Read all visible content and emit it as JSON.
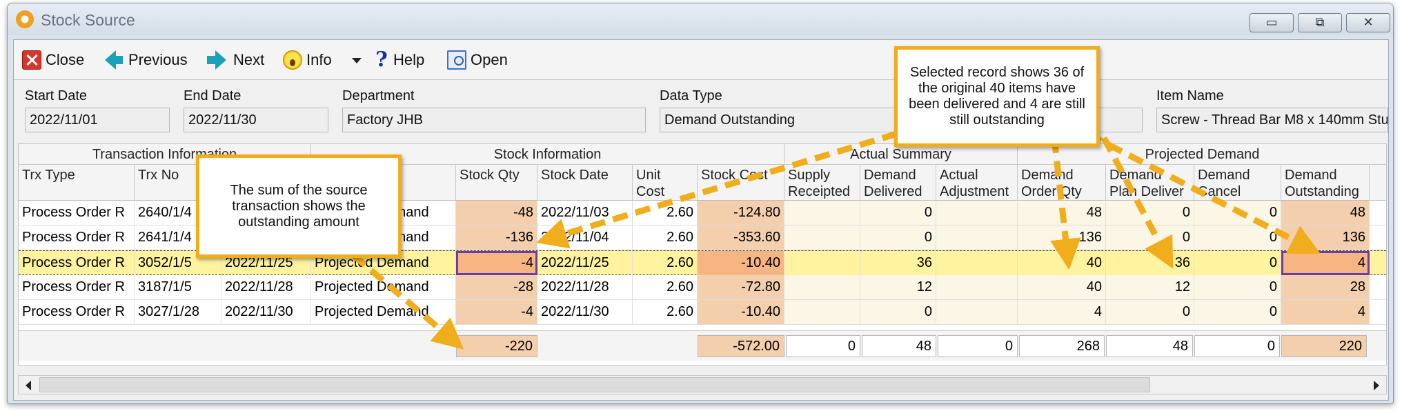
{
  "window": {
    "title": "Stock Source",
    "minimize": "▭",
    "maximize": "⧉",
    "close": "✕"
  },
  "toolbar": {
    "close_label": "Close",
    "previous_label": "Previous",
    "next_label": "Next",
    "info_label": "Info",
    "help_label": "Help",
    "open_label": "Open"
  },
  "filters": {
    "start_date": {
      "label": "Start Date",
      "value": "2022/11/01"
    },
    "end_date": {
      "label": "End Date",
      "value": "2022/11/30"
    },
    "department": {
      "label": "Department",
      "value": "Factory JHB"
    },
    "data_type": {
      "label": "Data Type",
      "value": "Demand Outstanding"
    },
    "item_name": {
      "label": "Item Name",
      "value": "Screw - Thread Bar M8 x 140mm Stu"
    }
  },
  "grid": {
    "bands": [
      "Transaction Information",
      "Stock Information",
      "Actual Summary",
      "Projected Demand"
    ],
    "headers": [
      "Trx Type",
      "Trx No",
      "",
      "",
      "Stock Qty",
      "Stock Date",
      "Unit\nCost",
      "Stock Cost",
      "Supply\nReceipted",
      "Demand\nDelivered",
      "Actual\nAdjustment",
      "Demand\nOrder Qty",
      "Demand\nPlan Deliver",
      "Demand\nCancel",
      "Demand\nOutstanding"
    ],
    "rows": [
      [
        "Process Order R",
        "2640/1/4",
        "",
        "Projected Demand",
        "-48",
        "2022/11/03",
        "2.60",
        "-124.80",
        "",
        "0",
        "",
        "48",
        "0",
        "0",
        "48"
      ],
      [
        "Process Order R",
        "2641/1/4",
        "",
        "Projected Demand",
        "-136",
        "2022/11/04",
        "2.60",
        "-353.60",
        "",
        "0",
        "",
        "136",
        "0",
        "0",
        "136"
      ],
      [
        "Process Order R",
        "3052/1/5",
        "2022/11/25",
        "Projected Demand",
        "-4",
        "2022/11/25",
        "2.60",
        "-10.40",
        "",
        "36",
        "",
        "40",
        "36",
        "0",
        "4"
      ],
      [
        "Process Order R",
        "3187/1/5",
        "2022/11/28",
        "Projected Demand",
        "-28",
        "2022/11/28",
        "2.60",
        "-72.80",
        "",
        "12",
        "",
        "40",
        "12",
        "0",
        "28"
      ],
      [
        "Process Order R",
        "3027/1/28",
        "2022/11/30",
        "Projected Demand",
        "-4",
        "2022/11/30",
        "2.60",
        "-10.40",
        "",
        "0",
        "",
        "4",
        "0",
        "0",
        "4"
      ]
    ],
    "selected_row": 2,
    "totals": {
      "stock_qty": "-220",
      "stock_cost": "-572.00",
      "supply_receipted": "0",
      "demand_delivered": "48",
      "actual_adjustment": "0",
      "demand_order_qty": "268",
      "demand_plan_deliver": "48",
      "demand_cancel": "0",
      "demand_outstanding": "220"
    }
  },
  "callouts": {
    "selected_record": "Selected record shows 36 of the original 40 items have been delivered and 4 are still still outstanding",
    "sum_source": "The sum of the source transaction shows the outstanding amount"
  },
  "colors": {
    "callout_border": "#f0ad1c",
    "selected_row": "#fff3a0",
    "peach": "#f3cfae",
    "highlight_box": "#6a3ea0"
  }
}
